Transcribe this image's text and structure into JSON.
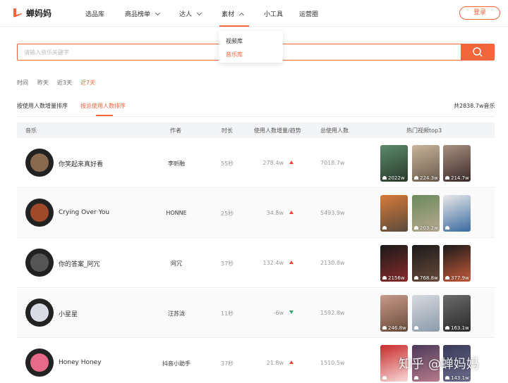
{
  "header": {
    "logo": "蝉妈妈",
    "nav": [
      "选品库",
      "商品榜单",
      "达人",
      "素材",
      "小工具",
      "运营圈"
    ],
    "login": "登录"
  },
  "dropdown": [
    "视频库",
    "音乐库"
  ],
  "search": {
    "placeholder": "请输入音乐关键字"
  },
  "filters": {
    "time_label": "时间",
    "time_options": [
      "昨天",
      "近3天",
      "近7天"
    ],
    "sort_tabs": [
      "按使用人数增量排序",
      "按总使用人数排序"
    ],
    "total": "共2838.7w音乐"
  },
  "table": {
    "headers": [
      "音乐",
      "作者",
      "时长",
      "使用人数增量/趋势",
      "总使用人数",
      "热门视频top3"
    ],
    "rows": [
      {
        "song": "你笑起来真好看",
        "author": "李昕融",
        "duration": "55秒",
        "increase": "278.4w",
        "trend": "up",
        "total": "7018.7w",
        "videos": [
          "2022w",
          "224.3w",
          "214.7w"
        ],
        "avatar": "#8a6a4e"
      },
      {
        "song": "Crying Over You",
        "author": "HONNE",
        "duration": "25秒",
        "increase": "34.8w",
        "trend": "up",
        "total": "5493.9w",
        "videos": [
          "",
          "203.2w",
          ""
        ],
        "avatar": "#a04a2a"
      },
      {
        "song": "你的答案_阿冗",
        "author": "阿冗",
        "duration": "37秒",
        "increase": "132.4w",
        "trend": "up",
        "total": "2130.8w",
        "videos": [
          "2156w",
          "768.8w",
          "377.9w"
        ],
        "avatar": "#555555"
      },
      {
        "song": "小星星",
        "author": "汪苏泷",
        "duration": "11秒",
        "increase": "-6w",
        "trend": "down",
        "total": "1592.8w",
        "videos": [
          "246.8w",
          "",
          "163.1w"
        ],
        "avatar": "#d8dbe3"
      },
      {
        "song": "Honey Honey",
        "author": "抖音小助手",
        "duration": "37秒",
        "increase": "21.8w",
        "trend": "up",
        "total": "1510.5w",
        "videos": [
          "",
          "",
          "143.1w"
        ],
        "avatar": "#e86a8a"
      }
    ]
  },
  "watermark": "知乎 @蝉妈妈",
  "colors": {
    "accent": "#f2663c",
    "up": "#e8473b",
    "down": "#2eaa6a"
  }
}
